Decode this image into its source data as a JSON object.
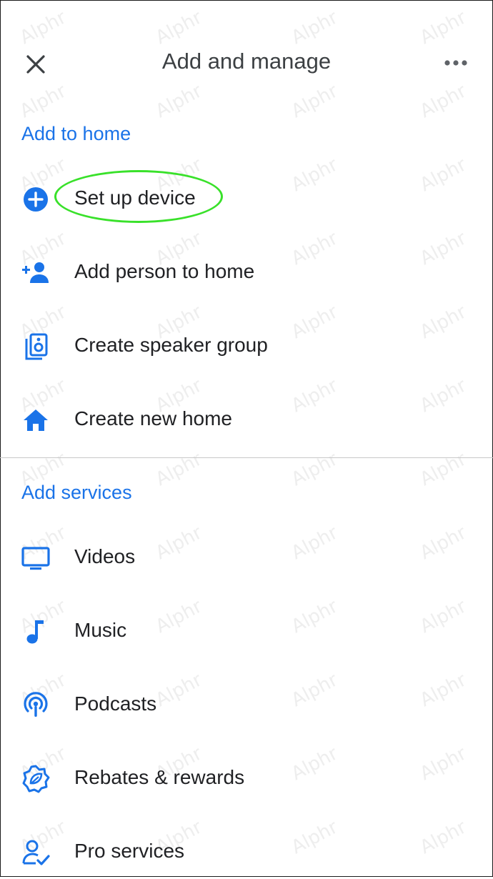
{
  "header": {
    "title": "Add and manage",
    "close_icon": "close-icon",
    "more_icon": "more-horizontal-icon"
  },
  "sections": [
    {
      "title": "Add to home",
      "items": [
        {
          "label": "Set up device",
          "icon": "add-circle-icon",
          "highlighted": true
        },
        {
          "label": "Add person to home",
          "icon": "person-add-icon"
        },
        {
          "label": "Create speaker group",
          "icon": "speaker-group-icon"
        },
        {
          "label": "Create new home",
          "icon": "home-icon"
        }
      ]
    },
    {
      "title": "Add services",
      "items": [
        {
          "label": "Videos",
          "icon": "tv-icon"
        },
        {
          "label": "Music",
          "icon": "music-note-icon"
        },
        {
          "label": "Podcasts",
          "icon": "podcasts-icon"
        },
        {
          "label": "Rebates & rewards",
          "icon": "rebates-badge-icon"
        },
        {
          "label": "Pro services",
          "icon": "pro-services-icon"
        }
      ]
    }
  ],
  "watermark": "Alphr",
  "colors": {
    "accent": "#1a73e8",
    "highlight_ring": "#39e12a",
    "text": "#202124"
  }
}
